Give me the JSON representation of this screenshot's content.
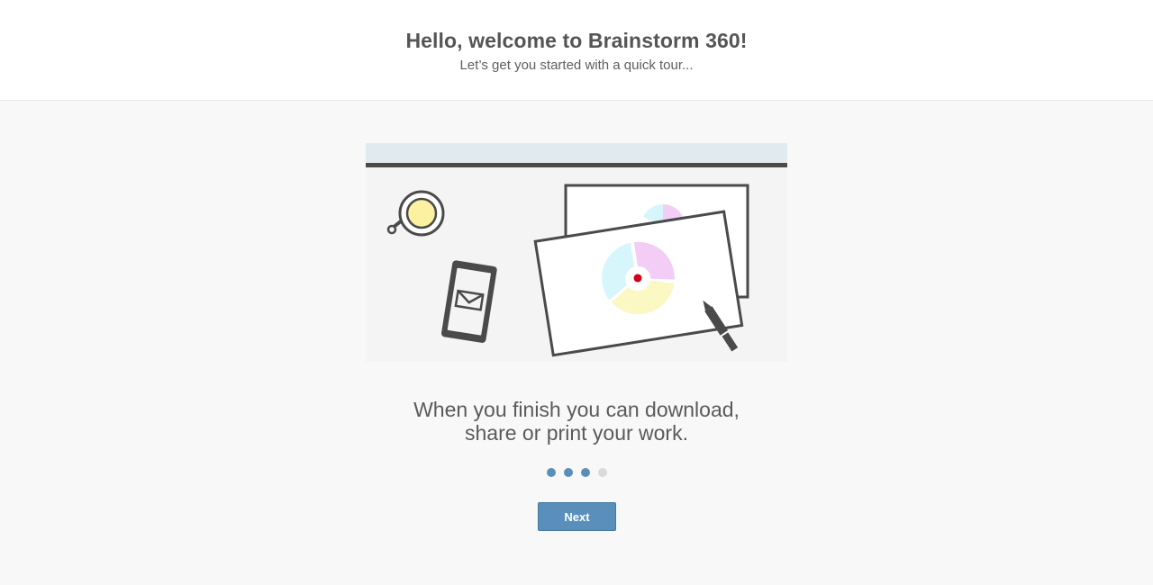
{
  "header": {
    "title": "Hello, welcome to Brainstorm 360!",
    "subtitle": "Let’s get you started with a quick tour..."
  },
  "illustration": {
    "icons": [
      "coffee-cup-icon",
      "phone-mail-icon",
      "paper-pie-chart-icon",
      "pen-icon"
    ],
    "colors": {
      "top_bar": "#e1eaee",
      "line": "#4a4a4a",
      "cup_fill": "#fbf1a0",
      "pie_cyan": "#d6f6fb",
      "pie_magenta": "#f3cdf6",
      "pie_yellow": "#fbf8c4",
      "center_dot": "#d0021b"
    }
  },
  "caption": {
    "line1": "When you finish you can download,",
    "line2": "share or print your work."
  },
  "progress": {
    "current_step": 3,
    "total_steps": 4
  },
  "actions": {
    "next_label": "Next"
  },
  "colors": {
    "accent": "#5a8fbb",
    "dot_inactive": "#dadada",
    "background": "#f7f8f7"
  }
}
